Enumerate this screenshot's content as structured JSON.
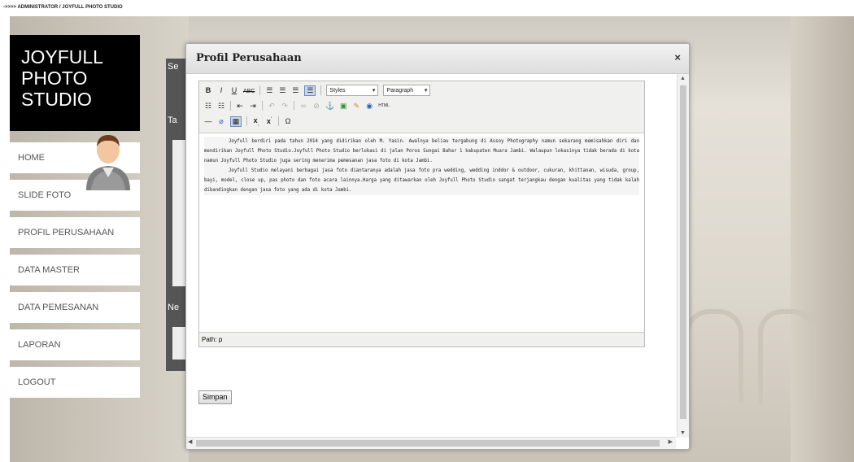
{
  "breadcrumb": "->>>> ADMINISTRATOR / JOYFULL PHOTO STUDIO",
  "brand": {
    "line1": "JOYFULL",
    "line2": "PHOTO",
    "line3": "STUDIO"
  },
  "menu": [
    {
      "label": "HOME"
    },
    {
      "label": "SLIDE FOTO"
    },
    {
      "label": "PROFIL PERUSAHAAN"
    },
    {
      "label": "DATA MASTER"
    },
    {
      "label": "DATA PEMESANAN"
    },
    {
      "label": "LAPORAN"
    },
    {
      "label": "LOGOUT"
    }
  ],
  "behind": {
    "t1": "Se",
    "t2": "Ta",
    "t3": "Ne"
  },
  "modal": {
    "title": "Profil Perusahaan",
    "close": "×",
    "editor": {
      "styles_select": "Styles",
      "format_select": "Paragraph",
      "paragraphs": [
        "Joyfull berdiri pada tahun 2014 yang didirikan oleh M. Yasin. Awalnya beliau tergabung di Assoy Photography namun sekarang memisahkan diri dan mendirikan Joyfull Photo Studio.Joyfull Photo Studio berlokasi di jalan Poros Sungai Bahar 1 kabupaten Muara Jambi. Walaupun lokasinya tidak berada di kota namun Joyfull Photo Studio juga sering menerima pemesanan jasa foto di kota Jambi.",
        "Joyfull Studio melayani berbagai jasa foto diantaranya adalah jasa foto pra wedding, wedding inddor & outdoor, cukuran, khittanan, wisuda, group, bayi, model, close up, pas photo dan foto acara lainnya.Harga yang ditawarkan oleh Joyfull Photo Studio sangat terjangkau dengan kualitas yang tidak kalah dibandingkan dengan jasa foto yang ada di kota Jambi."
      ],
      "path": "Path: p"
    },
    "save_label": "Simpan"
  }
}
